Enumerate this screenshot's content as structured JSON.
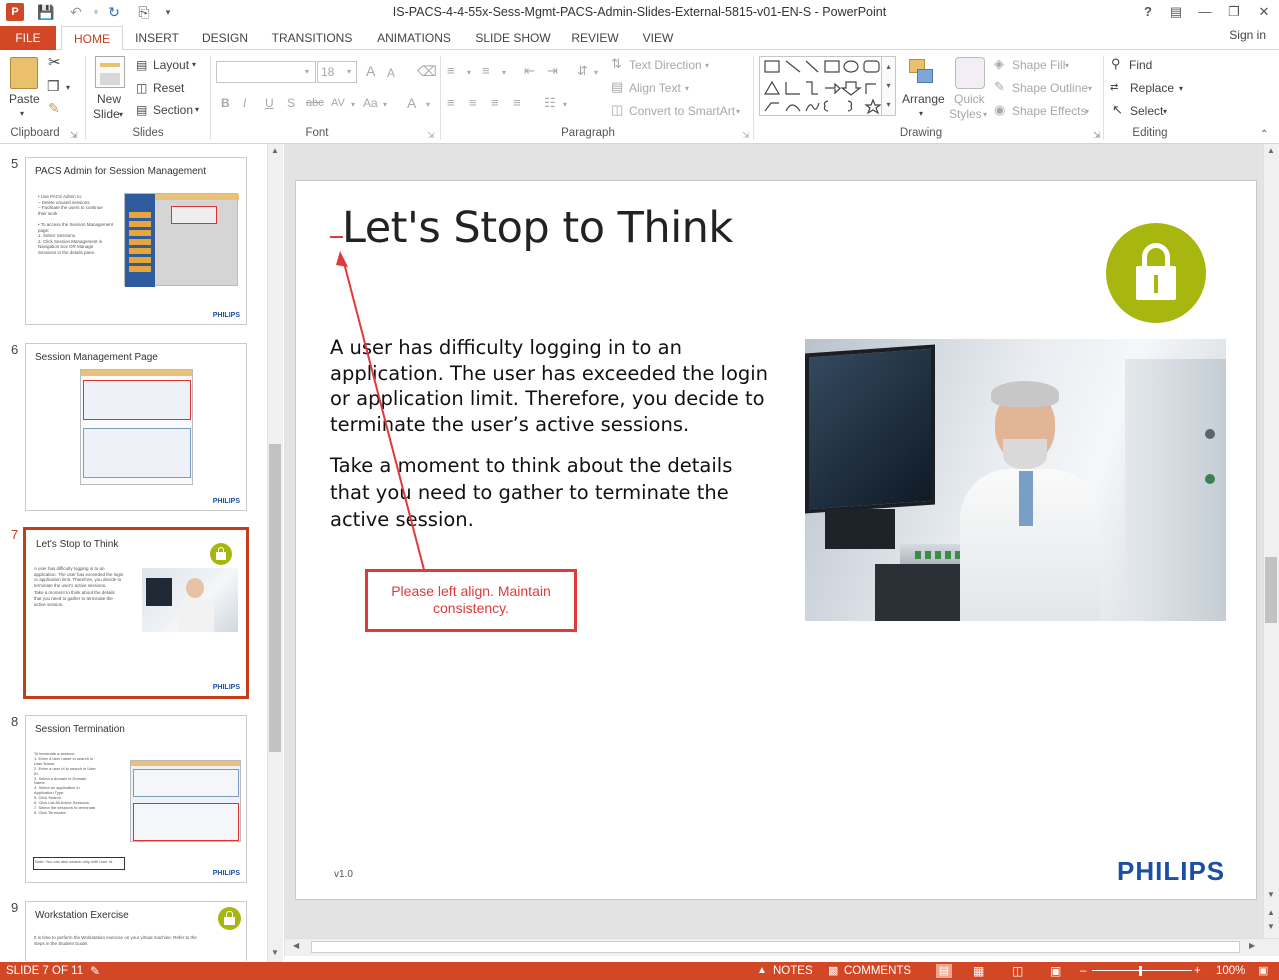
{
  "window": {
    "title": "IS-PACS-4-4-55x-Sess-Mgmt-PACS-Admin-Slides-External-5815-v01-EN-S - PowerPoint",
    "help": "?",
    "sign_in": "Sign in"
  },
  "tabs": [
    "FILE",
    "HOME",
    "INSERT",
    "DESIGN",
    "TRANSITIONS",
    "ANIMATIONS",
    "SLIDE SHOW",
    "REVIEW",
    "VIEW"
  ],
  "ribbon": {
    "clipboard": {
      "label": "Clipboard",
      "paste": "Paste"
    },
    "slides": {
      "label": "Slides",
      "new_slide_1": "New",
      "new_slide_2": "Slide",
      "layout": "Layout",
      "reset": "Reset",
      "section": "Section"
    },
    "font": {
      "label": "Font",
      "size": "18",
      "bold": "B",
      "italic": "I",
      "underline": "U",
      "shadow": "S",
      "strike": "abc",
      "spacing": "AV",
      "case": "Aa",
      "color": "A",
      "grow": "A",
      "shrink": "A"
    },
    "paragraph": {
      "label": "Paragraph",
      "text_direction": "Text Direction",
      "align_text": "Align Text",
      "smartart": "Convert to SmartArt"
    },
    "drawing": {
      "label": "Drawing",
      "arrange": "Arrange",
      "quick_styles_1": "Quick",
      "quick_styles_2": "Styles",
      "shape_fill": "Shape Fill",
      "shape_outline": "Shape Outline",
      "shape_effects": "Shape Effects"
    },
    "editing": {
      "label": "Editing",
      "find": "Find",
      "replace": "Replace",
      "select": "Select"
    }
  },
  "thumbnails": [
    {
      "num": "5",
      "title": "PACS Admin for Session Management",
      "lines": [
        "• Use PACS Admin to:",
        "  – Delete unused sessions",
        "  – Facilitate the users to continue",
        "    their work",
        "",
        "• To access the Session Management",
        "  page:",
        "  1. Select Sessions.",
        "  2. Click Session Management in",
        "     Navigation box OR Manage",
        "     Sessions in the details pane."
      ],
      "footer": "PHILIPS"
    },
    {
      "num": "6",
      "title": "Session Management Page",
      "lines": [],
      "footer": "PHILIPS"
    },
    {
      "num": "7",
      "title": "Let's Stop to Think",
      "lines": [
        "A user has difficulty logging in to an",
        "application. The user has exceeded the login",
        "or application limit. Therefore, you decide to",
        "terminate the user's active sessions.",
        "Take a moment to think about the details",
        "that you need to gather to terminate the",
        "active session."
      ],
      "footer": "PHILIPS"
    },
    {
      "num": "8",
      "title": "Session Termination",
      "lines": [
        "To terminate a session:",
        "1. Enter a user name to search in",
        "   User Name.",
        "2. Enter a user id to search in User",
        "   ID.",
        "3. Select a domain in Domain",
        "   Name.",
        "4. Select an application in",
        "   Application Type.",
        "5. Click Search.",
        "6. Click List All Active Sessions.",
        "7. Select the sessions to terminate.",
        "8. Click Terminate."
      ],
      "note": "Note: You can also search only with User Id.",
      "footer": "PHILIPS"
    },
    {
      "num": "9",
      "title": "Workstation Exercise",
      "lines": [
        "It is time to perform the Workstation exercise on your virtual machine. Refer to the",
        "steps in the Student Guide."
      ],
      "footer": ""
    }
  ],
  "slide": {
    "title": "Let's Stop to Think",
    "paragraph1": "A user has difficulty logging in to an application. The user has exceeded the login or application limit. Therefore, you decide to terminate the user’s active sessions.",
    "paragraph2": "Take a moment to think about the details that you need to gather to terminate the active session.",
    "callout": "Please left align. Maintain consistency.",
    "version": "v1.0",
    "logo": "PHILIPS",
    "accent_color": "#a7b70f",
    "logo_color": "#1c4fa3",
    "callout_color": "#e03a3a"
  },
  "status": {
    "slide_info": "SLIDE 7 OF 11",
    "notes": "NOTES",
    "comments": "COMMENTS",
    "zoom": "100%",
    "bar_color": "#d24726"
  }
}
